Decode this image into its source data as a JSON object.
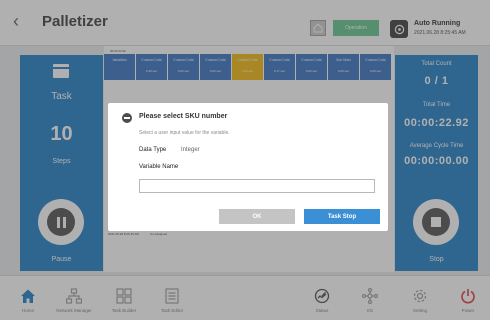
{
  "header": {
    "title": "Palletizer",
    "operation_label": "Operation",
    "status_title": "Auto Running",
    "status_time": "2021.06.28 8:25:45 AM"
  },
  "left_panel": {
    "task_label": "Task",
    "task_value": "10",
    "steps_label": "Steps",
    "pause_label": "Pause"
  },
  "right_panel": {
    "total_count_label": "Total Count",
    "total_count_value": "0 / 1",
    "total_time_label": "Total Time",
    "total_time_value": "00:00:22.92",
    "cycle_time_label": "Average Cycle Time",
    "cycle_time_value": "00:00:00.00",
    "stop_label": "Stop"
  },
  "timeline": {
    "label": "00:00:22.92",
    "steps": [
      {
        "name": "Variables",
        "time": "",
        "color": "#2f6cc0"
      },
      {
        "name": "CustomCode",
        "time": "0.39 sec",
        "color": "#2f6cc0"
      },
      {
        "name": "CustomCode",
        "time": "0.02 sec",
        "color": "#2f6cc0"
      },
      {
        "name": "CustomCode",
        "time": "0.02 sec",
        "color": "#2f6cc0"
      },
      {
        "name": "CustomCode",
        "time": "4.69 sec",
        "color": "#f0b400"
      },
      {
        "name": "CustomCode",
        "time": "0.17 sec",
        "color": "#2f6cc0"
      },
      {
        "name": "CustomCode",
        "time": "0.02 sec",
        "color": "#2f6cc0"
      },
      {
        "name": "Sub Main",
        "time": "0.09 sec",
        "color": "#2f6cc0"
      },
      {
        "name": "CustomCode",
        "time": "0.09 sec",
        "color": "#2f6cc0"
      }
    ],
    "legend_a": "2021.06.28 8:25:45 AM",
    "legend_b": "Un-Assigned"
  },
  "dialog": {
    "title": "Please select SKU number",
    "subtitle": "Select a user input value for the variable.",
    "data_type_label": "Data Type",
    "data_type_value": "Integer",
    "variable_name_label": "Variable Name",
    "input_value": "",
    "input_placeholder": "",
    "ok_label": "OK",
    "task_stop_label": "Task Stop"
  },
  "bottom_nav": [
    {
      "label": "Home",
      "icon": "home-icon",
      "color": "#1479c4"
    },
    {
      "label": "Network Manager",
      "icon": "network-icon",
      "color": "#9a9a9a"
    },
    {
      "label": "Task Builder",
      "icon": "grid-icon",
      "color": "#9a9a9a"
    },
    {
      "label": "Task Editor",
      "icon": "document-icon",
      "color": "#9a9a9a"
    },
    {
      "label": "Status",
      "icon": "gauge-icon",
      "color": "#444444"
    },
    {
      "label": "I/O",
      "icon": "io-icon",
      "color": "#9a9a9a"
    },
    {
      "label": "Setting",
      "icon": "gear-icon",
      "color": "#9a9a9a"
    },
    {
      "label": "Power",
      "icon": "power-icon",
      "color": "#e03030"
    }
  ]
}
